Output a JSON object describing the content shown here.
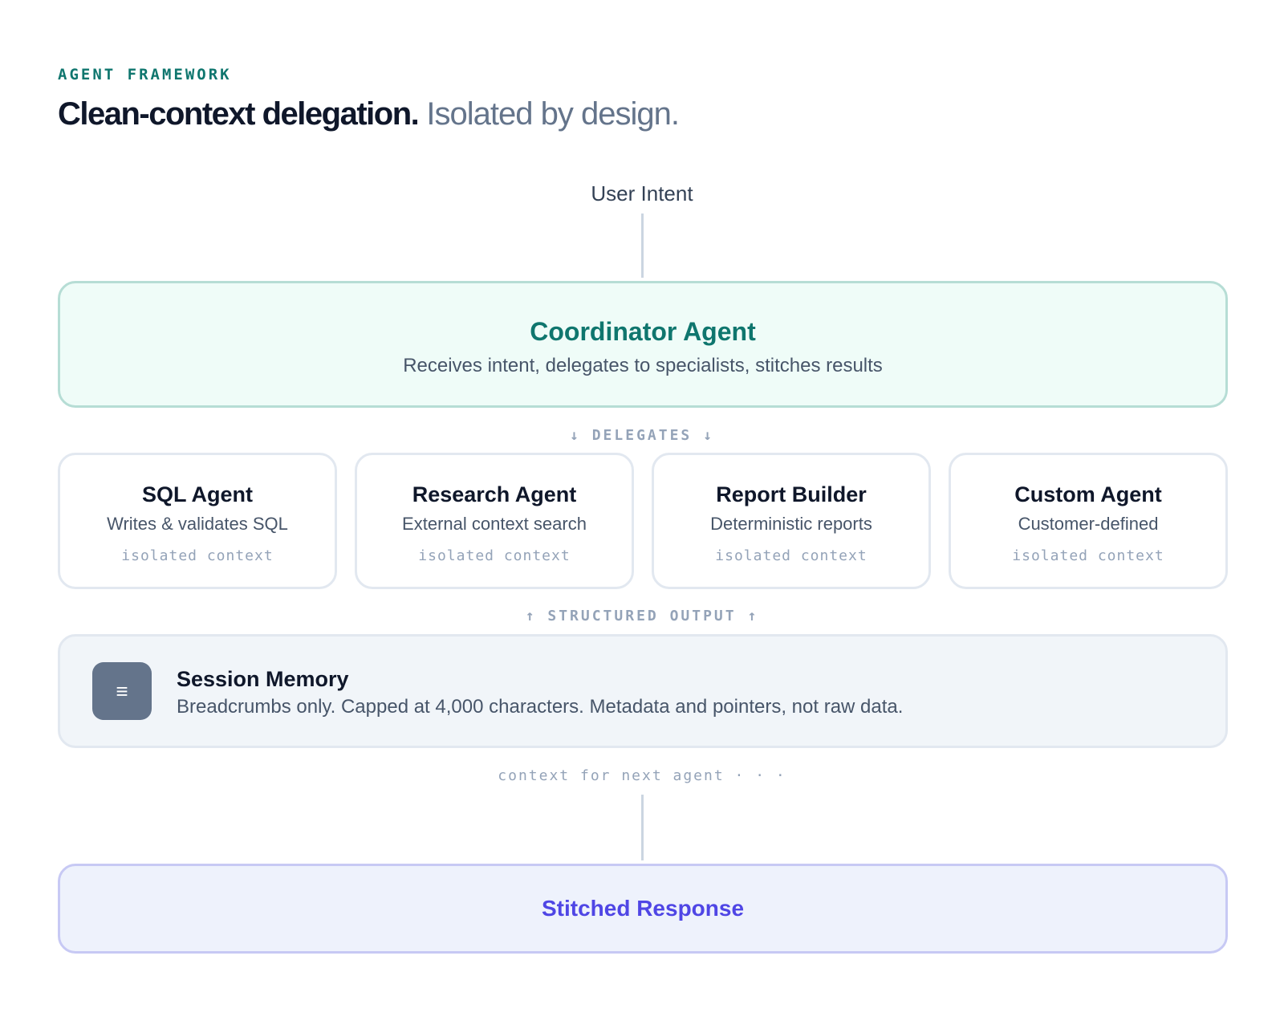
{
  "header": {
    "eyebrow": "AGENT FRAMEWORK",
    "headline_strong": "Clean-context delegation.",
    "headline_soft": "Isolated by design."
  },
  "diagram": {
    "user_intent": "User Intent",
    "coordinator": {
      "title": "Coordinator Agent",
      "subtitle": "Receives intent, delegates to specialists, stitches results"
    },
    "delegates_label": "↓ DELEGATES ↓",
    "agents": [
      {
        "name": "SQL Agent",
        "description": "Writes & validates SQL",
        "context": "isolated context"
      },
      {
        "name": "Research Agent",
        "description": "External context search",
        "context": "isolated context"
      },
      {
        "name": "Report Builder",
        "description": "Deterministic reports",
        "context": "isolated context"
      },
      {
        "name": "Custom Agent",
        "description": "Customer-defined",
        "context": "isolated context"
      }
    ],
    "structured_output_label": "↑ STRUCTURED OUTPUT ↑",
    "session_memory": {
      "icon": "menu-lines-icon",
      "icon_glyph": "≡",
      "title": "Session Memory",
      "description": "Breadcrumbs only. Capped at 4,000 characters. Metadata and pointers, not raw data."
    },
    "next_agent_label": "context for next agent · · ·",
    "stitched_response": "Stitched Response"
  },
  "colors": {
    "accent_teal": "#0f766e",
    "accent_indigo": "#4f46e5",
    "coordinator_bg": "#effcf8",
    "memory_bg": "#f1f5f9",
    "stitched_bg": "#eef2fc"
  }
}
